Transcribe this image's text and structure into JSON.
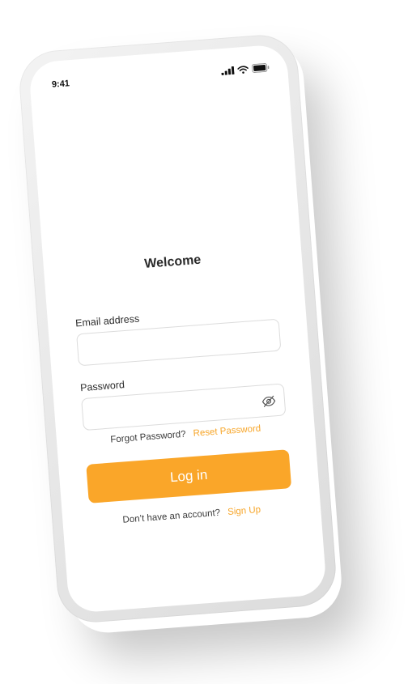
{
  "status_bar": {
    "time": "9:41",
    "icons": [
      "signal-icon",
      "wifi-icon",
      "battery-icon"
    ]
  },
  "login": {
    "title": "Welcome",
    "email": {
      "label": "Email address",
      "value": "",
      "placeholder": ""
    },
    "password": {
      "label": "Password",
      "value": "",
      "placeholder": "",
      "toggle_icon": "eye-off-icon"
    },
    "forgot_text": "Forgot Password?",
    "reset_link": "Reset Password",
    "login_button": "Log in",
    "no_account_text": "Don’t have an account?",
    "signup_link": "Sign Up"
  },
  "colors": {
    "accent": "#faa629",
    "text": "#2a2a2a",
    "border": "#dcdcdc",
    "background": "#ffffff"
  }
}
